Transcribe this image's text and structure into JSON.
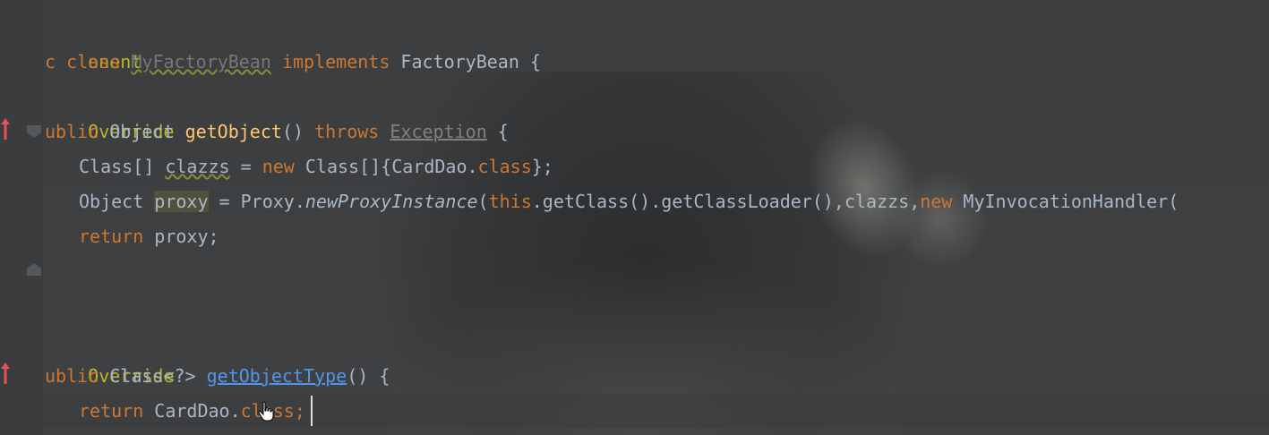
{
  "editor": {
    "lines": {
      "l1": {
        "text": "onent"
      },
      "l2": {
        "c": "c ",
        "class_kw": "class",
        "class_name": "MyFactoryBean",
        "implements_kw": "implements",
        "iface": "FactoryBean",
        "brace": "{"
      },
      "l3": {
        "text": "Override"
      },
      "l4": {
        "ublic": "ublic",
        "ret": "Object",
        "method": "getObject",
        "parens": "()",
        "throws_kw": "throws",
        "exc": "Exception",
        "brace": "{"
      },
      "l5": {
        "type": "Class[]",
        "var": "clazzs",
        "eq": " = ",
        "new_kw": "new",
        "rest": " Class[]{CardDao.",
        "class_kw": "class",
        "end": "};"
      },
      "l6": {
        "type": "Object ",
        "var": "proxy",
        "mid": " = Proxy.",
        "method": "newProxyInstance",
        "open": "(",
        "this_kw": "this",
        "calls": ".getClass().getClassLoader(),clazzs,",
        "new_kw": "new",
        "handler": " MyInvocationHandler("
      },
      "l7": {
        "return_kw": "return",
        "rest": " proxy;"
      },
      "l8": {
        "text": "Override"
      },
      "l9": {
        "ublic": "ublic",
        "ret": "Class<?>",
        "method": "getObjectType",
        "parens": "()",
        "brace": "{"
      },
      "l10": {
        "return_kw": "return",
        "rest": " CardDao.",
        "class_kw": "class",
        "semi": ";"
      }
    },
    "colors": {
      "background": "#3c3e40",
      "keyword": "#cc7832",
      "annotation": "#bbb529",
      "method": "#ffc66d",
      "plain": "#a9b7c6",
      "link": "#5394ec",
      "override_marker": "#e05555"
    }
  }
}
